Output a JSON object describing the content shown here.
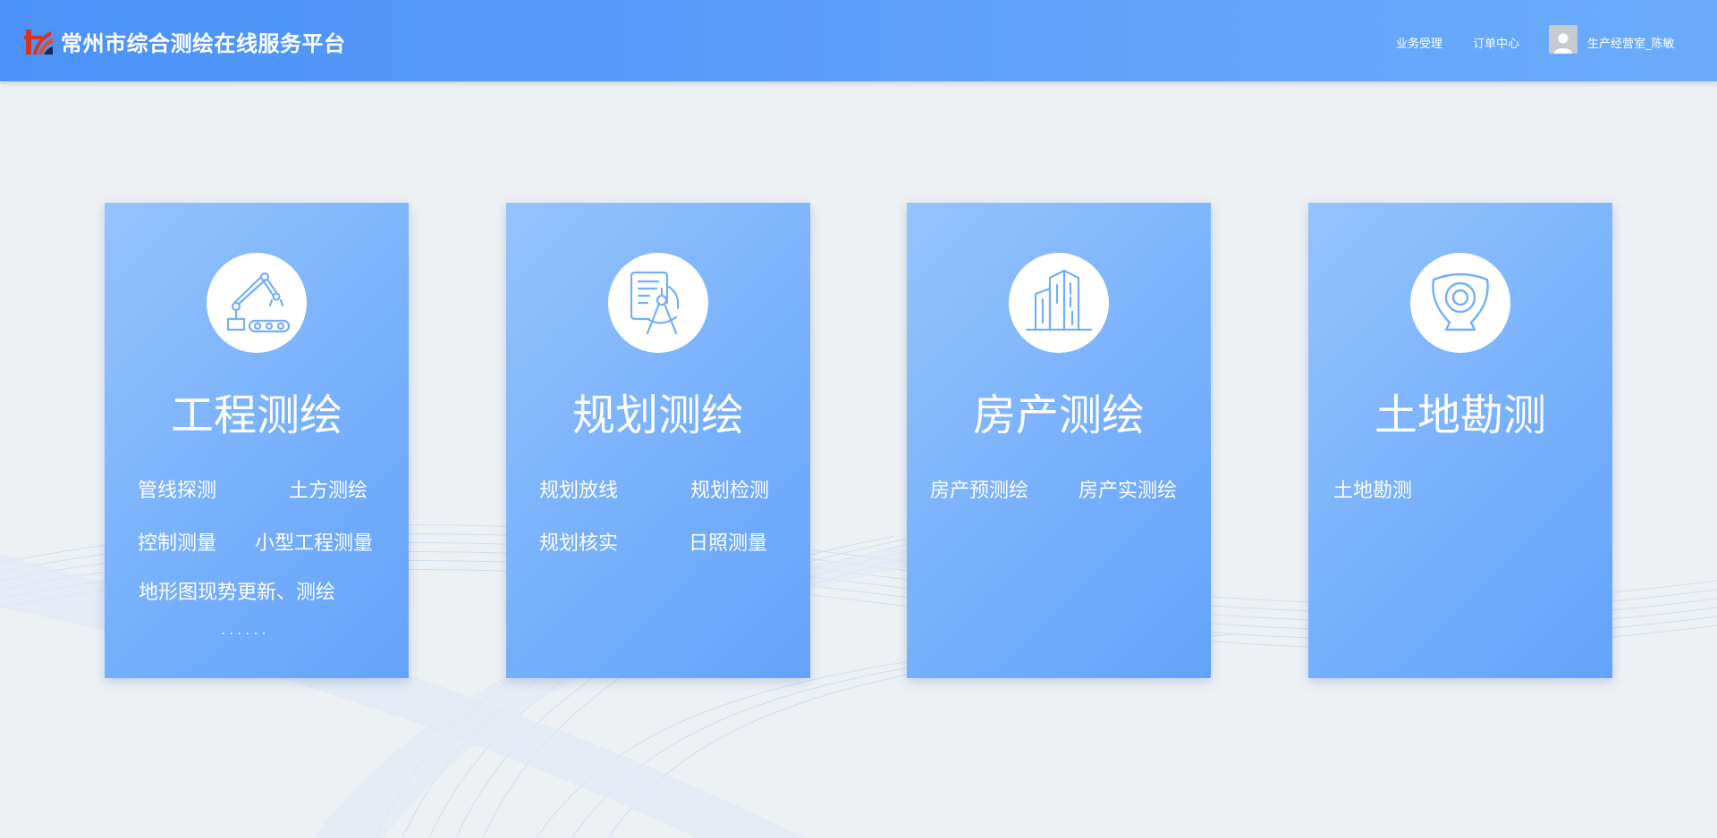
{
  "header": {
    "title": "常州市综合测绘在线服务平台",
    "nav": {
      "business": "业务受理",
      "orders": "订单中心"
    },
    "user": {
      "name": "生产经营室_陈敏"
    }
  },
  "cards": [
    {
      "icon": "robot-arm-icon",
      "title": "工程测绘",
      "items": [
        "管线探测",
        "土方测绘",
        "控制测量",
        "小型工程测量",
        "地形图现势更新、测绘"
      ],
      "more": "......"
    },
    {
      "icon": "compass-document-icon",
      "title": "规划测绘",
      "items": [
        "规划放线",
        "规划检测",
        "规划核实",
        "日照测量"
      ]
    },
    {
      "icon": "building-icon",
      "title": "房产测绘",
      "items": [
        "房产预测绘",
        "房产实测绘"
      ]
    },
    {
      "icon": "land-target-icon",
      "title": "土地勘测",
      "items": [
        "土地勘测"
      ]
    }
  ],
  "colors": {
    "header": "#4b91f7",
    "card": "#7ab2fc",
    "background": "#eef1f4",
    "logo_red": "#d9331f"
  }
}
